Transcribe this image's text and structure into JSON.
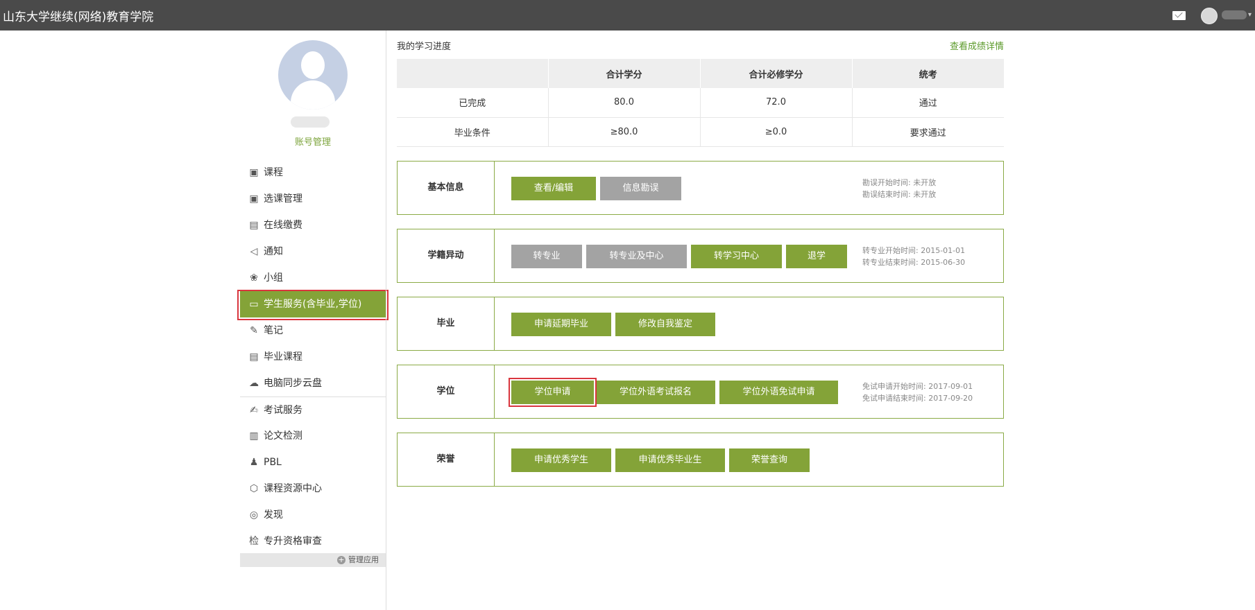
{
  "header": {
    "title": "山东大学继续(网络)教育学院"
  },
  "sidebar": {
    "account_link": "账号管理",
    "items": [
      {
        "label": "课程",
        "icon": "calendar-icon",
        "glyph": "▣"
      },
      {
        "label": "选课管理",
        "icon": "calendar-icon",
        "glyph": "▣"
      },
      {
        "label": "在线缴费",
        "icon": "document-icon",
        "glyph": "▤"
      },
      {
        "label": "通知",
        "icon": "speaker-icon",
        "glyph": "◁"
      },
      {
        "label": "小组",
        "icon": "group-icon",
        "glyph": "❀"
      },
      {
        "label": "学生服务(含毕业,学位)",
        "icon": "id-card-icon",
        "glyph": "▭"
      },
      {
        "label": "笔记",
        "icon": "note-icon",
        "glyph": "✎"
      },
      {
        "label": "毕业课程",
        "icon": "document-icon",
        "glyph": "▤"
      },
      {
        "label": "电脑同步云盘",
        "icon": "cloud-icon",
        "glyph": "☁"
      },
      {
        "label": "考试服务",
        "icon": "exam-icon",
        "glyph": "✍"
      },
      {
        "label": "论文检测",
        "icon": "book-icon",
        "glyph": "▥"
      },
      {
        "label": "PBL",
        "icon": "people-icon",
        "glyph": "♟"
      },
      {
        "label": "课程资源中心",
        "icon": "cube-icon",
        "glyph": "⬡"
      },
      {
        "label": "发现",
        "icon": "compass-icon",
        "glyph": "◎"
      },
      {
        "label": "专升资格审查",
        "icon": "check-doc-icon",
        "glyph": "检"
      }
    ],
    "manage_label": "管理应用"
  },
  "progress": {
    "title": "我的学习进度",
    "view_link": "查看成绩详情",
    "headers": [
      "",
      "合计学分",
      "合计必修学分",
      "统考"
    ],
    "rows": [
      [
        "已完成",
        "80.0",
        "72.0",
        "通过"
      ],
      [
        "毕业条件",
        "≥80.0",
        "≥0.0",
        "要求通过"
      ]
    ]
  },
  "panels": {
    "basic": {
      "label": "基本信息",
      "btn1": "查看/编辑",
      "btn2": "信息勘误",
      "note1": "勘误开始时间: 未开放",
      "note2": "勘误结束时间: 未开放"
    },
    "status": {
      "label": "学籍异动",
      "btn1": "转专业",
      "btn2": "转专业及中心",
      "btn3": "转学习中心",
      "btn4": "退学",
      "note1": "转专业开始时间: 2015-01-01",
      "note2": "转专业结束时间: 2015-06-30"
    },
    "graduate": {
      "label": "毕业",
      "btn1": "申请延期毕业",
      "btn2": "修改自我鉴定"
    },
    "degree": {
      "label": "学位",
      "btn1": "学位申请",
      "btn2": "学位外语考试报名",
      "btn3": "学位外语免试申请",
      "note1": "免试申请开始时间: 2017-09-01",
      "note2": "免试申请结束时间: 2017-09-20"
    },
    "honor": {
      "label": "荣誉",
      "btn1": "申请优秀学生",
      "btn2": "申请优秀毕业生",
      "btn3": "荣誉查询"
    }
  },
  "colors": {
    "accent": "#84a338",
    "header_bg": "#4a4a4a",
    "disabled": "#a3a3a3",
    "highlight": "#d9363e"
  }
}
